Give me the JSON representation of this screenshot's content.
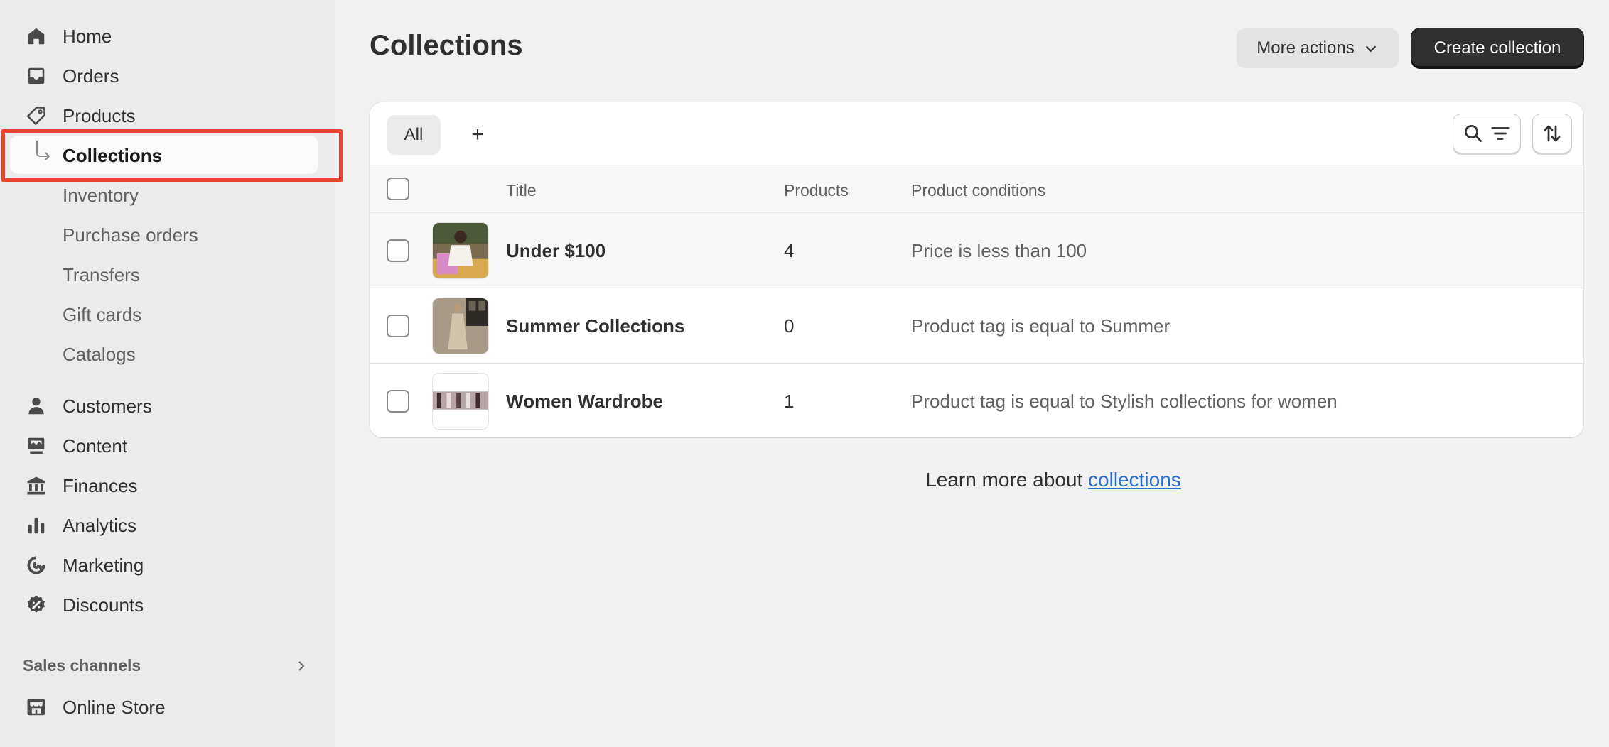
{
  "sidebar": {
    "items": [
      {
        "label": "Home",
        "icon": "home-icon"
      },
      {
        "label": "Orders",
        "icon": "inbox-icon"
      },
      {
        "label": "Products",
        "icon": "tag-icon"
      },
      {
        "label": "Collections",
        "icon": "",
        "active": true
      },
      {
        "label": "Inventory"
      },
      {
        "label": "Purchase orders"
      },
      {
        "label": "Transfers"
      },
      {
        "label": "Gift cards"
      },
      {
        "label": "Catalogs"
      },
      {
        "label": "Customers",
        "icon": "person-icon"
      },
      {
        "label": "Content",
        "icon": "content-icon"
      },
      {
        "label": "Finances",
        "icon": "bank-icon"
      },
      {
        "label": "Analytics",
        "icon": "bar-chart-icon"
      },
      {
        "label": "Marketing",
        "icon": "target-icon"
      },
      {
        "label": "Discounts",
        "icon": "discount-icon"
      }
    ],
    "sales_channels_label": "Sales channels",
    "online_store_label": "Online Store"
  },
  "header": {
    "title": "Collections",
    "more_actions_label": "More actions",
    "create_label": "Create collection"
  },
  "tabs": {
    "all_label": "All",
    "add_label": "+"
  },
  "table": {
    "headers": {
      "title": "Title",
      "products": "Products",
      "conditions": "Product conditions"
    },
    "rows": [
      {
        "title": "Under $100",
        "products": "4",
        "conditions": "Price is less than 100"
      },
      {
        "title": "Summer Collections",
        "products": "0",
        "conditions": "Product tag is equal to Summer"
      },
      {
        "title": "Women Wardrobe",
        "products": "1",
        "conditions": "Product tag is equal to Stylish collections for women"
      }
    ]
  },
  "footer": {
    "learn_more_prefix": "Learn more about ",
    "learn_more_link": "collections"
  },
  "colors": {
    "highlight": "#e8452c",
    "primary_button": "#303030",
    "link": "#2c6ecb"
  }
}
